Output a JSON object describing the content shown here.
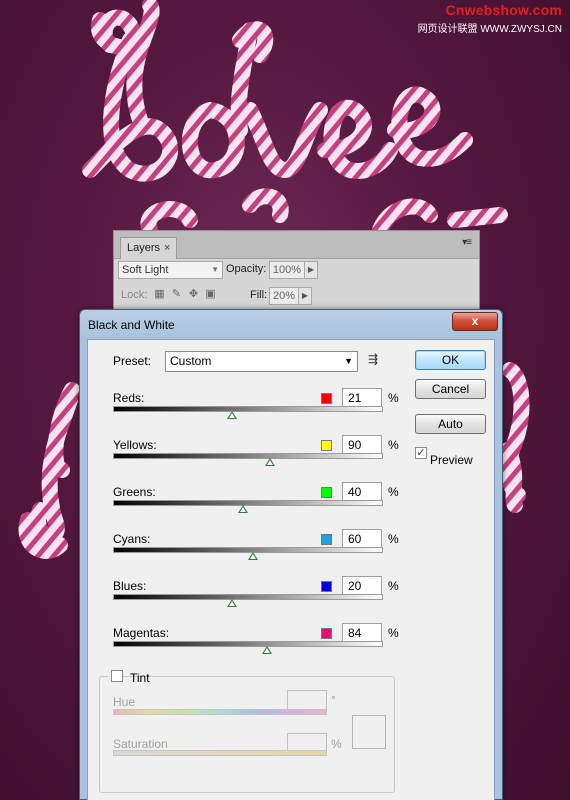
{
  "watermark": {
    "main": "Cnwebshow.com",
    "sub": "网页设计联盟 WWW.ZWYSJ.CN"
  },
  "layers_panel": {
    "tab_label": "Layers",
    "tab_close": "×",
    "blend_mode": "Soft Light",
    "opacity_label": "Opacity:",
    "opacity_value": "100%",
    "lock_label": "Lock:",
    "fill_label": "Fill:",
    "fill_value": "20%"
  },
  "dialog": {
    "title": "Black and White",
    "close_glyph": "x",
    "preset_label": "Preset:",
    "preset_value": "Custom",
    "buttons": {
      "ok": "OK",
      "cancel": "Cancel",
      "auto": "Auto"
    },
    "preview_label": "Preview",
    "preview_checked": true,
    "channels": [
      {
        "label": "Reds:",
        "value": "21",
        "unit": "%",
        "color": "#ff0000",
        "slider_pos": 0.44
      },
      {
        "label": "Yellows:",
        "value": "90",
        "unit": "%",
        "color": "#ffff00",
        "slider_pos": 0.58
      },
      {
        "label": "Greens:",
        "value": "40",
        "unit": "%",
        "color": "#00ff00",
        "slider_pos": 0.48
      },
      {
        "label": "Cyans:",
        "value": "60",
        "unit": "%",
        "color": "#1aa3e0",
        "slider_pos": 0.52
      },
      {
        "label": "Blues:",
        "value": "20",
        "unit": "%",
        "color": "#0000dd",
        "slider_pos": 0.44
      },
      {
        "label": "Magentas:",
        "value": "84",
        "unit": "%",
        "color": "#e0107a",
        "slider_pos": 0.57
      }
    ],
    "tint": {
      "label": "Tint",
      "checked": false,
      "hue_label": "Hue",
      "hue_unit": "°",
      "saturation_label": "Saturation",
      "saturation_unit": "%"
    }
  }
}
